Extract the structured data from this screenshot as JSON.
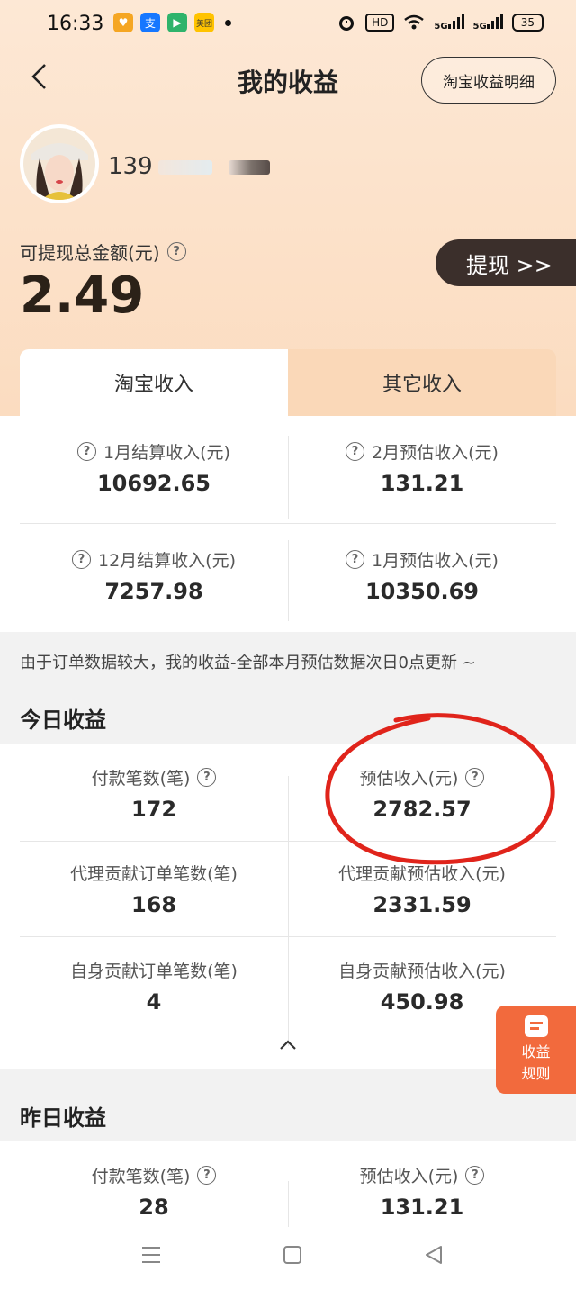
{
  "status_bar": {
    "time": "16:33",
    "network_badge": "HD",
    "signal1": "5G",
    "signal2": "5G",
    "battery": "35",
    "apps": [
      {
        "name": "app-heart-icon",
        "label": "♥",
        "color": "#f5a623"
      },
      {
        "name": "alipay-icon",
        "label": "支",
        "color": "#1677ff"
      },
      {
        "name": "app-play-icon",
        "label": "▶",
        "color": "#2fb36b"
      },
      {
        "name": "meituan-icon",
        "label": "美团",
        "color": "#ffc300"
      }
    ]
  },
  "header": {
    "title": "我的收益",
    "detail_button": "淘宝收益明细"
  },
  "user": {
    "name_visible": "139"
  },
  "withdraw": {
    "label": "可提现总金额(元)",
    "amount": "2.49",
    "button": "提现 >>"
  },
  "tabs": [
    {
      "label": "淘宝收入",
      "active": true
    },
    {
      "label": "其它收入",
      "active": false
    }
  ],
  "settlement": [
    {
      "label": "1月结算收入(元)",
      "value": "10692.65"
    },
    {
      "label": "2月预估收入(元)",
      "value": "131.21"
    },
    {
      "label": "12月结算收入(元)",
      "value": "7257.98"
    },
    {
      "label": "1月预估收入(元)",
      "value": "10350.69"
    }
  ],
  "notice": "由于订单数据较大，我的收益-全部本月预估数据次日0点更新 ~",
  "today": {
    "title": "今日收益",
    "stats": [
      {
        "label": "付款笔数(笔)",
        "value": "172",
        "help": true
      },
      {
        "label": "预估收入(元)",
        "value": "2782.57",
        "help": true
      },
      {
        "label": "代理贡献订单笔数(笔)",
        "value": "168",
        "help": false
      },
      {
        "label": "代理贡献预估收入(元)",
        "value": "2331.59",
        "help": false
      },
      {
        "label": "自身贡献订单笔数(笔)",
        "value": "4",
        "help": false
      },
      {
        "label": "自身贡献预估收入(元)",
        "value": "450.98",
        "help": false
      }
    ]
  },
  "yesterday": {
    "title": "昨日收益",
    "stats": [
      {
        "label": "付款笔数(笔)",
        "value": "28",
        "help": true
      },
      {
        "label": "预估收入(元)",
        "value": "131.21",
        "help": true
      }
    ]
  },
  "rules_button": {
    "line1": "收益",
    "line2": "规则"
  },
  "colors": {
    "hero_bg": "#fde8d5",
    "accent_orange": "#f26a3d",
    "annotation_red": "#e0241b",
    "withdraw_btn": "#3b2f2b"
  }
}
